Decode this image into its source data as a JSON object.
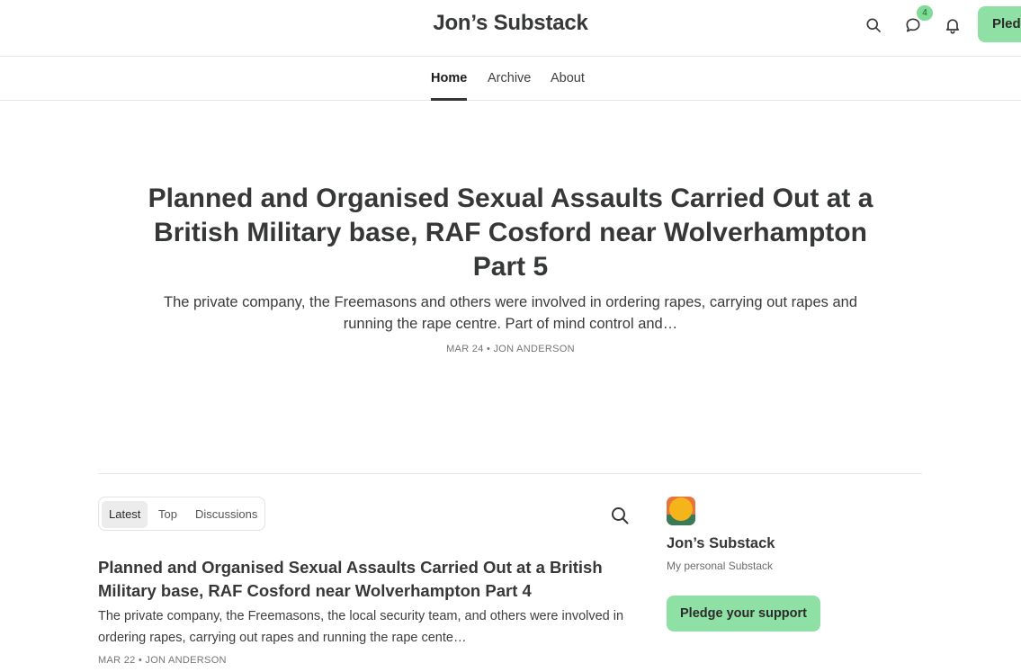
{
  "header": {
    "site_title": "Jon’s Substack",
    "icons": [
      "search-icon",
      "chat-icon",
      "bell-icon"
    ],
    "notification_count": "4",
    "pledge_label": "Pledge your support"
  },
  "nav": {
    "items": [
      {
        "label": "Home",
        "active": true
      },
      {
        "label": "Archive",
        "active": false
      },
      {
        "label": "About",
        "active": false
      }
    ]
  },
  "hero": {
    "title": "Planned and Organised Sexual Assaults Carried Out at a British Military base, RAF Cosford near Wolverhampton Part 5",
    "subtitle": "The private company, the Freemasons and others were involved in ordering rapes, carrying out rapes and running the rape centre. Part of mind control and…",
    "meta": "MAR 24 • JON ANDERSON"
  },
  "feed": {
    "tabs": [
      {
        "label": "Latest",
        "active": true
      },
      {
        "label": "Top",
        "active": false
      },
      {
        "label": "Discussions",
        "active": false
      }
    ],
    "posts": [
      {
        "title": "Planned and Organised Sexual Assaults Carried Out at a British Military base, RAF Cosford near Wolverhampton Part 4",
        "subtitle": "The private company, the Freemasons, the local security team, and others were involved in ordering rapes, carrying out rapes and running the rape cente…",
        "meta": "MAR 22 • JON ANDERSON"
      }
    ]
  },
  "sidebar": {
    "name": "Jon’s Substack",
    "description": "My personal Substack",
    "pledge_label": "Pledge your support"
  },
  "colors": {
    "accent": "#8fe0a4",
    "badge": "#7fdc97",
    "text": "#363737"
  }
}
